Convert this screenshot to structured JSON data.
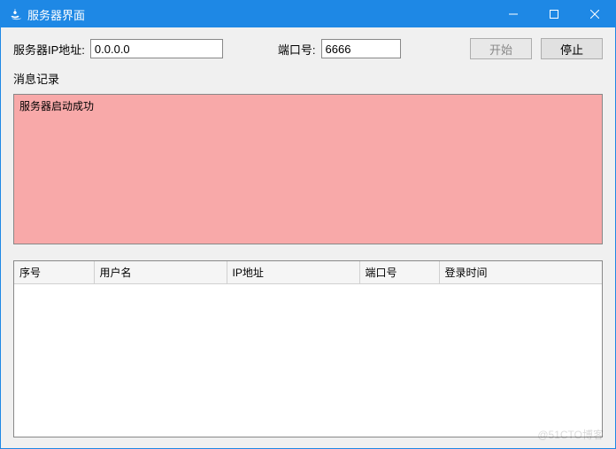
{
  "window": {
    "title": "服务器界面"
  },
  "config": {
    "ip_label": "服务器IP地址:",
    "ip_value": "0.0.0.0",
    "port_label": "端口号:",
    "port_value": "6666",
    "start_label": "开始",
    "stop_label": "停止"
  },
  "log": {
    "label": "消息记录",
    "content": "服务器启动成功"
  },
  "table": {
    "headers": [
      "序号",
      "用户名",
      "IP地址",
      "端口号",
      "登录时间"
    ]
  },
  "watermark": "@51CTO博客"
}
